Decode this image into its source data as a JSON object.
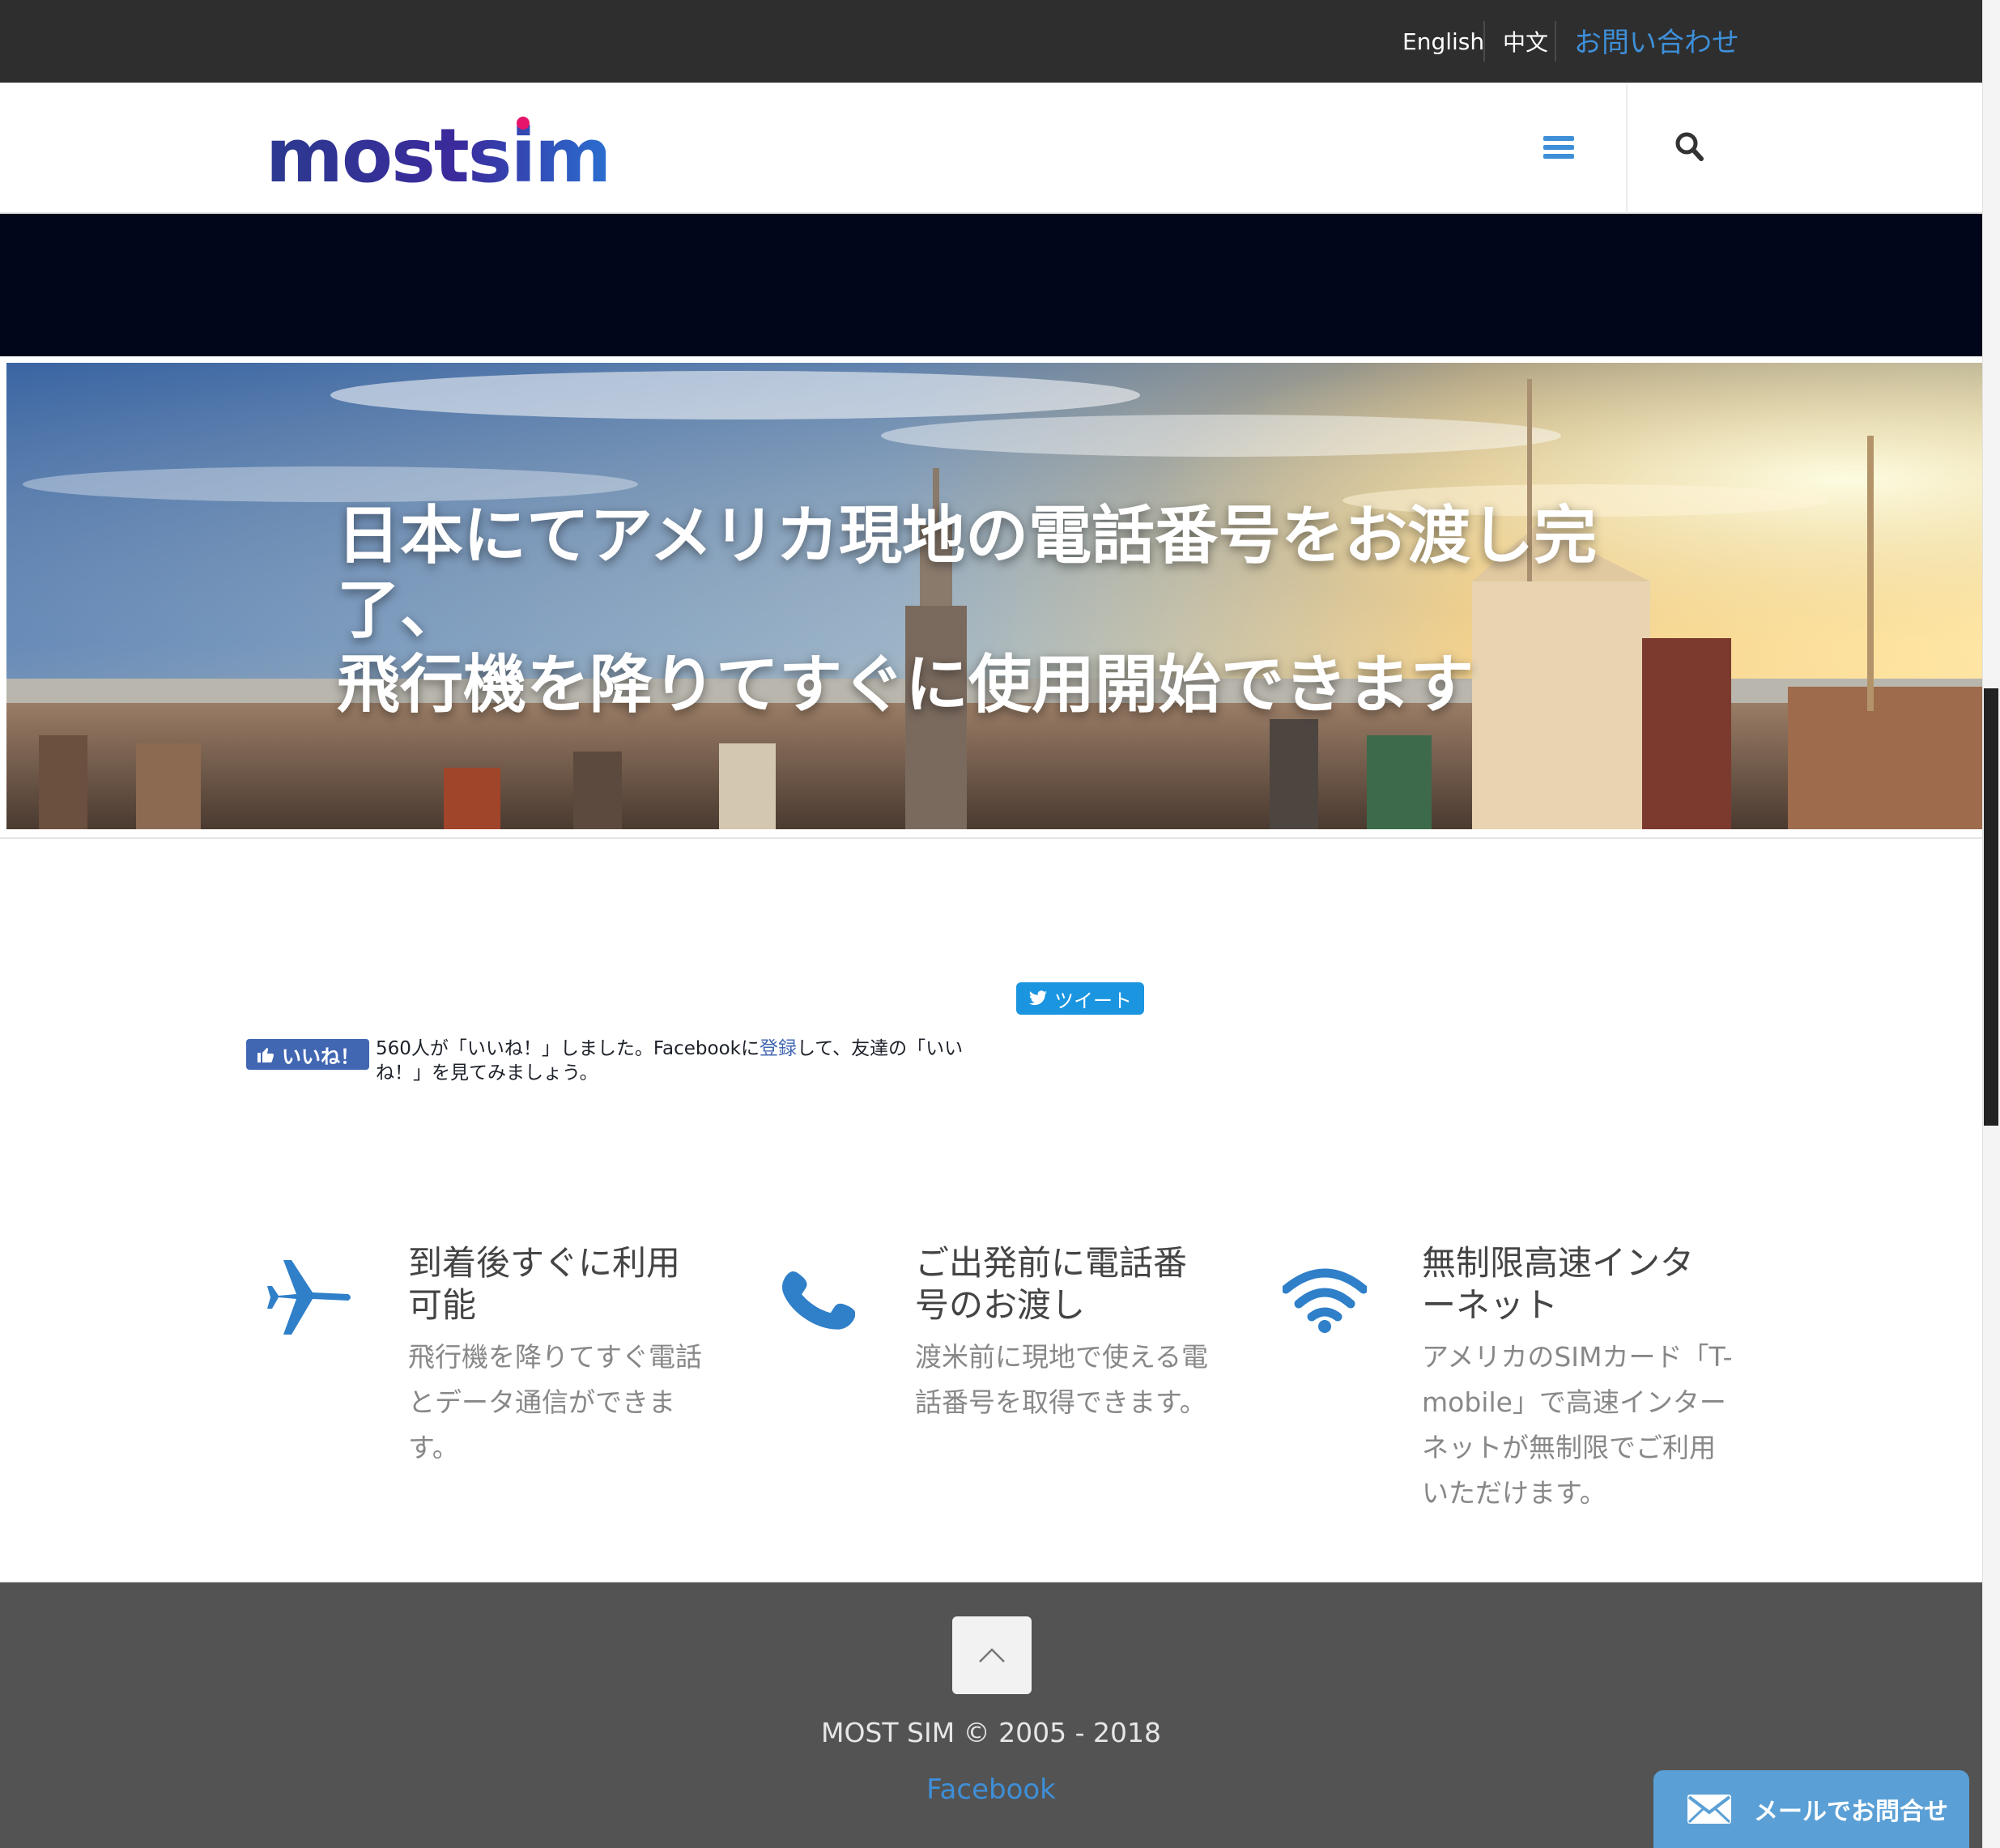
{
  "topbar": {
    "lang_en": "English",
    "lang_zh": "中文",
    "contact": "お問い合わせ",
    "contact_color": "#3e8fd8"
  },
  "header": {
    "logo_text": "mostsim",
    "menu_icon": "hamburger-icon",
    "search_icon": "search-icon"
  },
  "hero": {
    "line1": "日本にてアメリカ現地の電話番号をお渡し完了、",
    "line2": "飛行機を降りてすぐに使用開始できます"
  },
  "social": {
    "tweet_label": "ツイート",
    "like_label": "いいね！",
    "like_text_before": "560人が「いいね！」しました。Facebookに",
    "like_text_link": "登録",
    "like_text_after": "して、友達の「いいね！」を見てみましょう。"
  },
  "features": [
    {
      "icon": "airplane-icon",
      "title": "到着後すぐに利用可能",
      "body": "飛行機を降りてすぐ電話とデータ通信ができます。"
    },
    {
      "icon": "phone-icon",
      "title": "ご出発前に電話番号のお渡し",
      "body": "渡米前に現地で使える電話番号を取得できます。"
    },
    {
      "icon": "wifi-icon",
      "title": "無制限高速インターネット",
      "body": "アメリカのSIMカード「T-mobile」で高速インターネットが無制限でご利用いただけます。"
    }
  ],
  "footer": {
    "copyright": "MOST SIM © 2005 - 2018",
    "facebook": "Facebook"
  },
  "mail_widget": {
    "label": "メールでお問合せ"
  },
  "colors": {
    "accent": "#3e8fd8",
    "topbar": "#2e2e2e",
    "footer": "#535353",
    "darkband": "#02061a"
  }
}
